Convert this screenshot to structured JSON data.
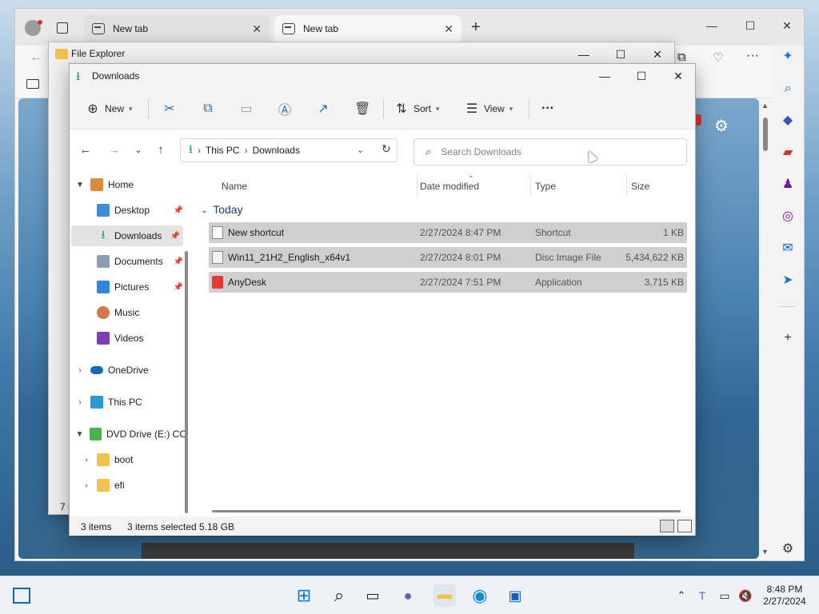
{
  "browser": {
    "tabs": [
      {
        "label": "New tab",
        "close": "✕"
      },
      {
        "label": "New tab",
        "close": "✕"
      }
    ],
    "new_tab": "+",
    "controls": {
      "minimize": "—",
      "maximize": "☐",
      "close": "✕"
    }
  },
  "explorer_back": {
    "title": "File Explorer",
    "controls": {
      "minimize": "—",
      "maximize": "☐",
      "close": "✕"
    }
  },
  "explorer": {
    "title": "Downloads",
    "controls": {
      "minimize": "—",
      "maximize": "☐",
      "close": "✕"
    },
    "commands": {
      "new": "New",
      "sort": "Sort",
      "view": "View",
      "more": "···"
    },
    "address": {
      "segments": [
        "This PC",
        "Downloads"
      ],
      "separator": "›"
    },
    "search": {
      "placeholder": "Search Downloads"
    },
    "nav": [
      {
        "label": "Home",
        "icon": "home-icon"
      },
      {
        "label": "Desktop",
        "icon": "desktop-icon",
        "pinned": true
      },
      {
        "label": "Downloads",
        "icon": "download-icon",
        "pinned": true,
        "selected": true
      },
      {
        "label": "Documents",
        "icon": "documents-icon",
        "pinned": true
      },
      {
        "label": "Pictures",
        "icon": "pictures-icon",
        "pinned": true
      },
      {
        "label": "Music",
        "icon": "music-icon"
      },
      {
        "label": "Videos",
        "icon": "videos-icon"
      },
      {
        "label": "OneDrive",
        "icon": "cloud-icon"
      },
      {
        "label": "This PC",
        "icon": "computer-icon"
      },
      {
        "label": "DVD Drive (E:) CC",
        "icon": "dvd-icon"
      },
      {
        "label": "boot",
        "icon": "folder-icon"
      },
      {
        "label": "efi",
        "icon": "folder-icon"
      }
    ],
    "columns": {
      "name": "Name",
      "date": "Date modified",
      "type": "Type",
      "size": "Size"
    },
    "group": "Today",
    "files": [
      {
        "name": "New shortcut",
        "date": "2/27/2024 8:47 PM",
        "type": "Shortcut",
        "size": "1 KB"
      },
      {
        "name": "Win11_21H2_English_x64v1",
        "date": "2/27/2024 8:01 PM",
        "type": "Disc Image File",
        "size": "5,434,622 KB"
      },
      {
        "name": "AnyDesk",
        "date": "2/27/2024 7:51 PM",
        "type": "Application",
        "size": "3,715 KB"
      }
    ],
    "status": {
      "items": "3 items",
      "selected": "3 items selected",
      "size": "5.18 GB"
    }
  },
  "back_window_status": "7 i",
  "taskbar": {
    "clock_time": "8:48 PM",
    "clock_date": "2/27/2024"
  }
}
